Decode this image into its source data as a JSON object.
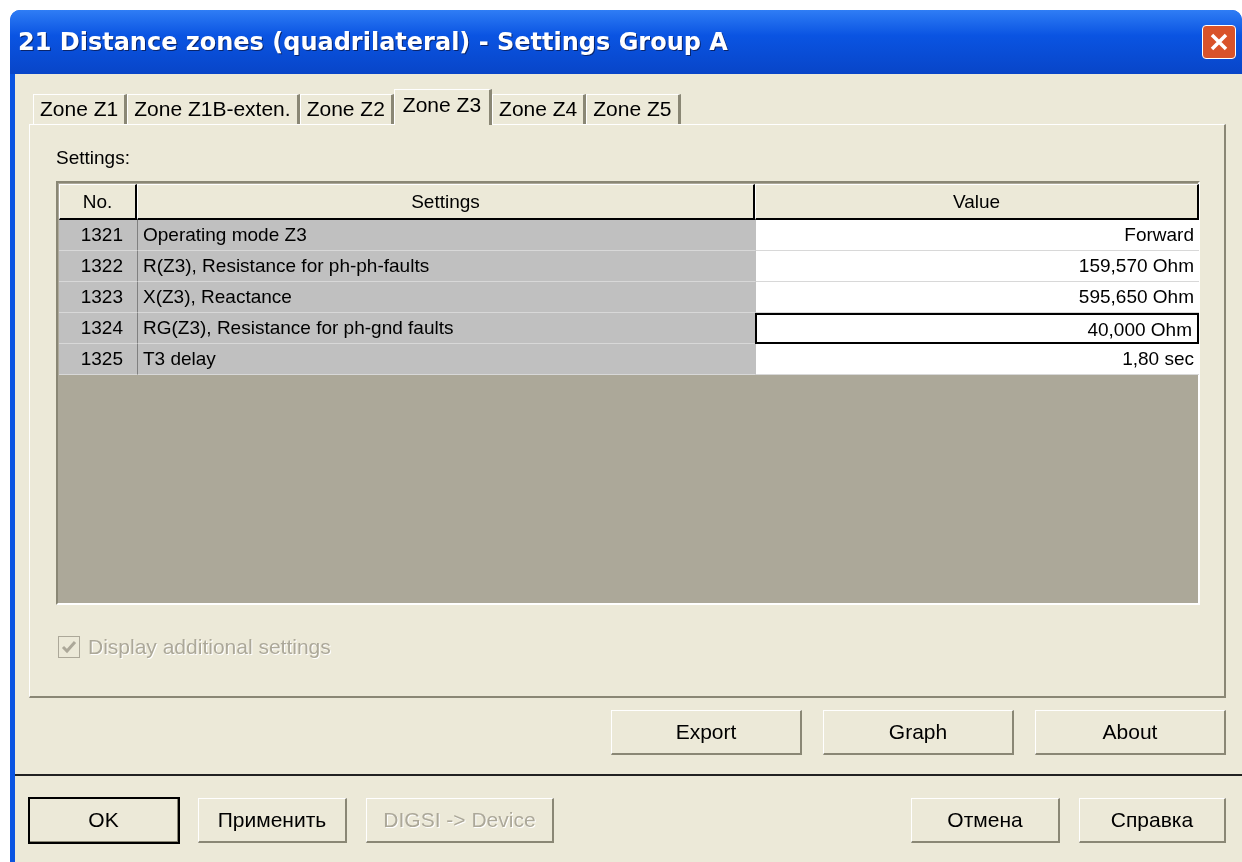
{
  "window": {
    "title": "21 Distance zones (quadrilateral) - Settings Group A"
  },
  "tabs": [
    {
      "label": "Zone Z1",
      "selected": false
    },
    {
      "label": "Zone Z1B-exten.",
      "selected": false
    },
    {
      "label": "Zone Z2",
      "selected": false
    },
    {
      "label": "Zone Z3",
      "selected": true
    },
    {
      "label": "Zone Z4",
      "selected": false
    },
    {
      "label": "Zone Z5",
      "selected": false
    }
  ],
  "settings_label": "Settings:",
  "table": {
    "columns": [
      "No.",
      "Settings",
      "Value"
    ],
    "rows": [
      {
        "no": "1321",
        "setting": "Operating mode Z3",
        "value": "Forward",
        "focused": false
      },
      {
        "no": "1322",
        "setting": "R(Z3), Resistance for ph-ph-faults",
        "value": "159,570 Ohm",
        "focused": false
      },
      {
        "no": "1323",
        "setting": "X(Z3), Reactance",
        "value": "595,650 Ohm",
        "focused": false
      },
      {
        "no": "1324",
        "setting": "RG(Z3), Resistance for ph-gnd faults",
        "value": "40,000 Ohm",
        "focused": true
      },
      {
        "no": "1325",
        "setting": "T3 delay",
        "value": "1,80 sec",
        "focused": false
      }
    ]
  },
  "display_additional": {
    "label": "Display additional settings",
    "checked": true,
    "disabled": true
  },
  "panel_buttons": [
    {
      "label": "Export",
      "disabled": false
    },
    {
      "label": "Graph",
      "disabled": false
    },
    {
      "label": "About",
      "disabled": false
    }
  ],
  "dialog_buttons_left": [
    {
      "label": "OK",
      "disabled": false,
      "default": true
    },
    {
      "label": "Применить",
      "disabled": false,
      "default": false
    },
    {
      "label": "DIGSI -> Device",
      "disabled": true,
      "default": false
    }
  ],
  "dialog_buttons_right": [
    {
      "label": "Отмена",
      "disabled": false,
      "default": false
    },
    {
      "label": "Справка",
      "disabled": false,
      "default": false
    }
  ]
}
